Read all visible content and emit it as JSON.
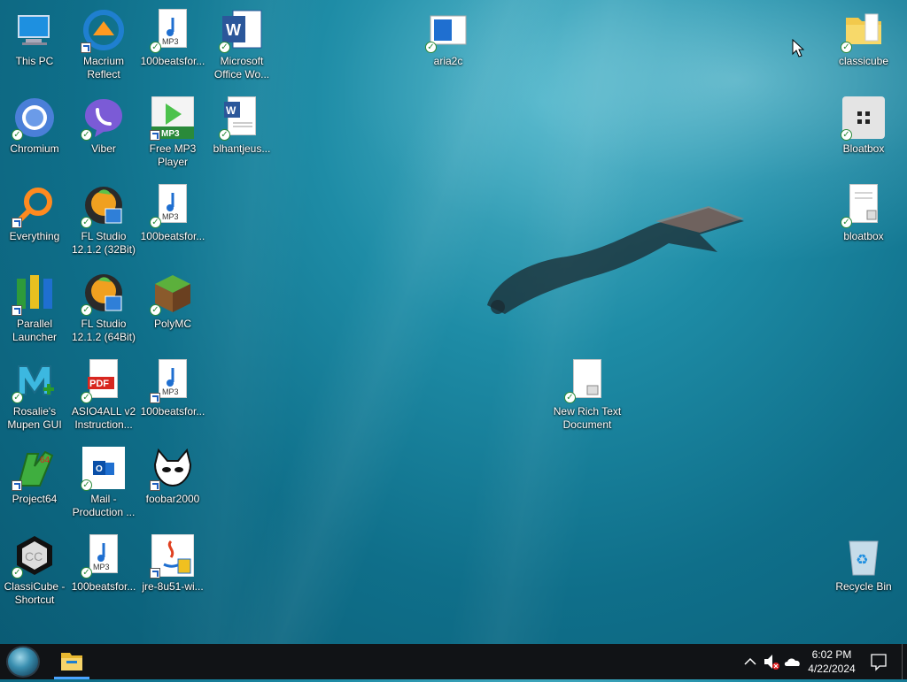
{
  "desktop_icons": [
    {
      "label": "This PC",
      "icon": "computer-icon"
    },
    {
      "label": "Macrium Reflect",
      "icon": "macrium-icon"
    },
    {
      "label": "100beatsfor...",
      "icon": "mp3-file-icon"
    },
    {
      "label": "Microsoft Office Wo...",
      "icon": "word-icon"
    },
    {
      "label": "Chromium",
      "icon": "chromium-icon"
    },
    {
      "label": "Viber",
      "icon": "viber-icon"
    },
    {
      "label": "Free MP3 Player",
      "icon": "mp3-player-icon"
    },
    {
      "label": "blhantjeus...",
      "icon": "word-doc-icon"
    },
    {
      "label": "Everything",
      "icon": "search-icon"
    },
    {
      "label": "FL Studio 12.1.2 (32Bit)",
      "icon": "fl-studio-icon"
    },
    {
      "label": "100beatsfor...",
      "icon": "mp3-file-icon"
    },
    {
      "label": "Parallel Launcher",
      "icon": "parallel-launcher-icon"
    },
    {
      "label": "FL Studio 12.1.2 (64Bit)",
      "icon": "fl-studio-icon"
    },
    {
      "label": "PolyMC",
      "icon": "polymc-icon"
    },
    {
      "label": "Rosalie's Mupen GUI",
      "icon": "mupen-icon"
    },
    {
      "label": "ASIO4ALL v2 Instruction...",
      "icon": "pdf-icon"
    },
    {
      "label": "100beatsfor...",
      "icon": "mp3-file-icon"
    },
    {
      "label": "Project64",
      "icon": "project64-icon"
    },
    {
      "label": "Mail - Production ...",
      "icon": "outlook-icon"
    },
    {
      "label": "foobar2000",
      "icon": "foobar-icon"
    },
    {
      "label": "ClassiCube - Shortcut",
      "icon": "classicube-icon"
    },
    {
      "label": "100beatsfor...",
      "icon": "mp3-file-icon"
    },
    {
      "label": "jre-8u51-wi...",
      "icon": "java-installer-icon"
    },
    {
      "label": "aria2c",
      "icon": "aria2c-icon"
    },
    {
      "label": "New Rich Text Document",
      "icon": "rtf-icon"
    },
    {
      "label": "classicube",
      "icon": "folder-icon"
    },
    {
      "label": "Bloatbox",
      "icon": "bloatbox-icon"
    },
    {
      "label": "bloatbox",
      "icon": "text-file-icon"
    },
    {
      "label": "Recycle Bin",
      "icon": "recycle-bin-icon"
    }
  ],
  "taskbar": {
    "start_icon": "start-orb-icon",
    "pinned": [
      {
        "name": "File Explorer",
        "icon": "folder-icon"
      }
    ],
    "tray": {
      "chevron_icon": "chevron-up-icon",
      "volume_icon": "volume-muted-icon",
      "onedrive_icon": "cloud-icon",
      "time": "6:02 PM",
      "date": "4/22/2024",
      "notification_icon": "notification-icon"
    }
  },
  "colors": {
    "taskbar": "#111316",
    "check_green": "#2a8a3a",
    "water_dark": "#0a5a73",
    "water_light": "#4fb4c8"
  }
}
